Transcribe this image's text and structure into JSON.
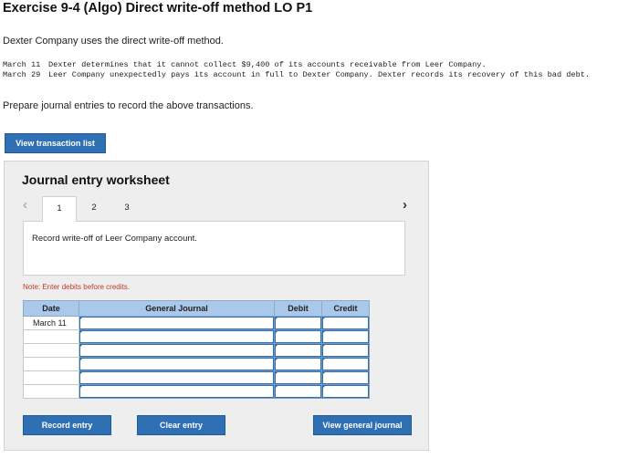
{
  "title": "Exercise 9-4 (Algo) Direct write-off method LO P1",
  "intro": "Dexter Company uses the direct write-off method.",
  "transactions": [
    {
      "date": "March 11",
      "text": "Dexter determines that it cannot collect $9,400 of its accounts receivable from Leer Company."
    },
    {
      "date": "March 29",
      "text": "Leer Company unexpectedly pays its account in full to Dexter Company. Dexter records its recovery of this bad debt."
    }
  ],
  "prompt": "Prepare journal entries to record the above transactions.",
  "view_transaction_list_label": "View transaction list",
  "worksheet": {
    "title": "Journal entry worksheet",
    "nav_prev_icon": "‹",
    "nav_next_icon": "›",
    "tabs": [
      "1",
      "2",
      "3"
    ],
    "active_tab": 0,
    "description": "Record write-off of Leer Company account.",
    "note": "Note: Enter debits before credits.",
    "table": {
      "headers": [
        "Date",
        "General Journal",
        "Debit",
        "Credit"
      ],
      "rows": [
        {
          "date": "March 11",
          "account": "",
          "debit": "",
          "credit": ""
        },
        {
          "date": "",
          "account": "",
          "debit": "",
          "credit": ""
        },
        {
          "date": "",
          "account": "",
          "debit": "",
          "credit": ""
        },
        {
          "date": "",
          "account": "",
          "debit": "",
          "credit": ""
        },
        {
          "date": "",
          "account": "",
          "debit": "",
          "credit": ""
        },
        {
          "date": "",
          "account": "",
          "debit": "",
          "credit": ""
        }
      ]
    },
    "buttons": {
      "record": "Record entry",
      "clear": "Clear entry",
      "view_general_journal": "View general journal"
    }
  },
  "colors": {
    "button_blue": "#2f6fb4",
    "table_header": "#a9c8ea",
    "note_red": "#c0392b",
    "worksheet_bg": "#eeeeee"
  }
}
